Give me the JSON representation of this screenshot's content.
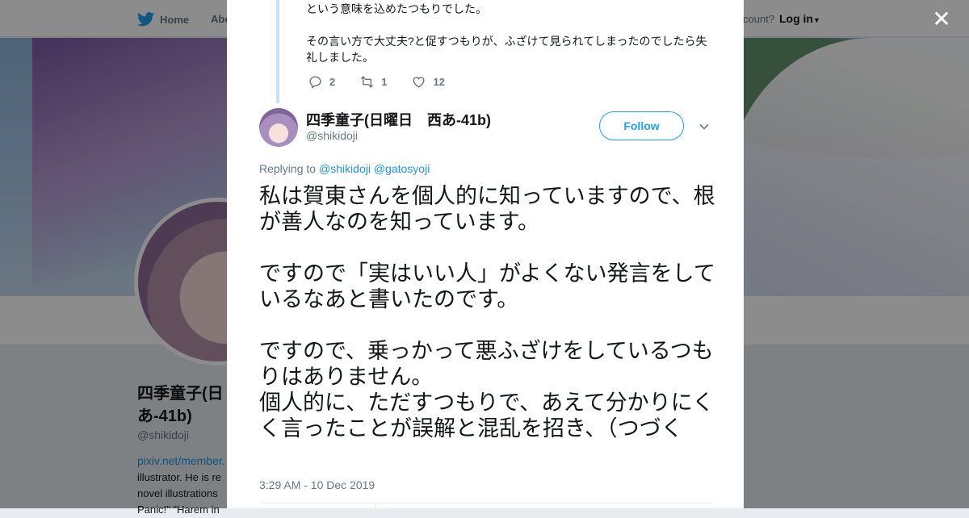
{
  "topbar": {
    "home_label": "Home",
    "about_label": "Abo",
    "account_text": "count?",
    "login_label": "Log in"
  },
  "background_profile": {
    "name": "四季童子(日\nあ-41b)",
    "handle": "@shikidoji",
    "link": "pixiv.net/member.",
    "bio_lines": [
      "illustrator. He is re",
      "novel illustrations",
      "Panic!\" \"Harem in"
    ]
  },
  "modal": {
    "previous_tweet": {
      "paragraphs": [
        "という意味を込めたつもりでした。",
        "その言い方で大丈夫?と促すつもりが、ふざけて見られてしまったのでしたら失礼しました。"
      ],
      "replies": "2",
      "retweets": "1",
      "likes": "12"
    },
    "tweet": {
      "author_name": "四季童子(日曜日　西あ-41b)",
      "author_handle": "@shikidoji",
      "follow_label": "Follow",
      "replying_prefix": "Replying to ",
      "replying_to": [
        "@shikidoji",
        "@gatosyoji"
      ],
      "text_paragraphs": [
        "私は賀東さんを個人的に知っていますので、根が善人なのを知っています。",
        "ですので「実はいい人」がよくない発言をしているなあと書いたのです。",
        "ですので、乗っかって悪ふざけをしているつもりはありません。",
        "個人的に、ただすつもりで、あえて分かりにくく言ったことが誤解と混乱を招き、（つづく"
      ],
      "timestamp": "3:29 AM - 10 Dec 2019"
    }
  },
  "colors": {
    "accent": "#1da1f2",
    "link": "#1b95e0",
    "muted": "#657786",
    "thread_line": "#c6e4f5"
  },
  "icons": {
    "logo": "twitter-bird-icon",
    "reply": "reply-icon",
    "retweet": "retweet-icon",
    "like": "heart-icon",
    "close": "close-icon",
    "more": "chevron-down-icon"
  }
}
